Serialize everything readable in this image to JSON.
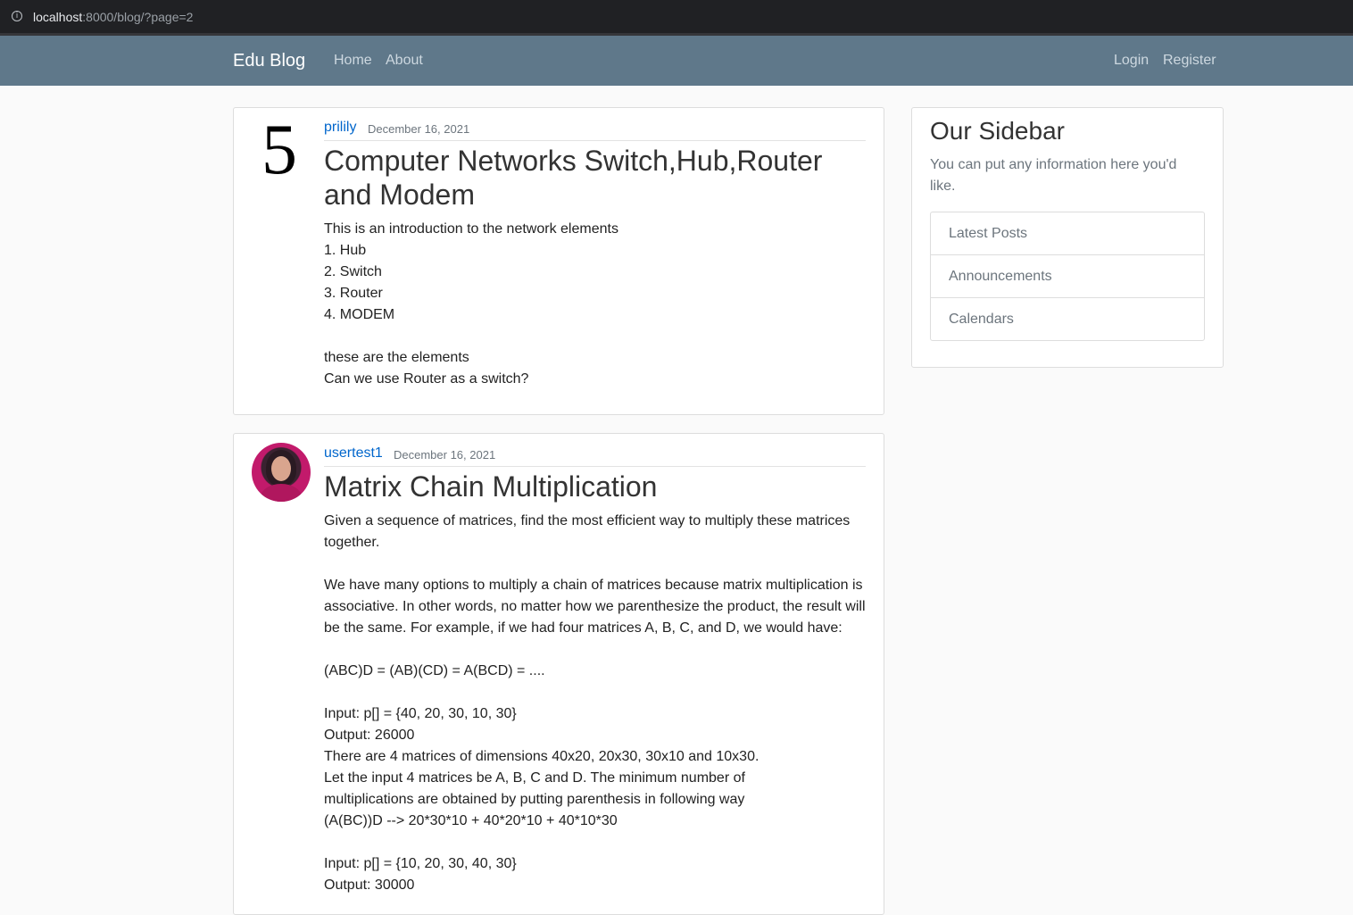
{
  "browser": {
    "url_host": "localhost",
    "url_rest": ":8000/blog/?page=2",
    "info_icon": "info-icon"
  },
  "navbar": {
    "brand": "Edu Blog",
    "links": {
      "home": "Home",
      "about": "About",
      "login": "Login",
      "register": "Register"
    },
    "background": "#5f788a"
  },
  "posts": [
    {
      "avatar_text": "5",
      "author": "prilily",
      "date": "December 16, 2021",
      "title": "Computer Networks Switch,Hub,Router and Modem",
      "content": "This is an introduction to the network elements\n1. Hub\n2. Switch\n3. Router\n4. MODEM\n\nthese are the elements\nCan we use Router as a switch?"
    },
    {
      "avatar_icon": "user-avatar-photo",
      "author": "usertest1",
      "date": "December 16, 2021",
      "title": "Matrix Chain Multiplication",
      "content": "Given a sequence of matrices, find the most efficient way to multiply these matrices together.\n\nWe have many options to multiply a chain of matrices because matrix multiplication is associative. In other words, no matter how we parenthesize the product, the result will be the same. For example, if we had four matrices A, B, C, and D, we would have:\n\n(ABC)D = (AB)(CD) = A(BCD) = ....\n\nInput: p[] = {40, 20, 30, 10, 30}\nOutput: 26000\nThere are 4 matrices of dimensions 40x20, 20x30, 30x10 and 10x30.\nLet the input 4 matrices be A, B, C and D. The minimum number of\nmultiplications are obtained by putting parenthesis in following way\n(A(BC))D --> 20*30*10 + 40*20*10 + 40*10*30\n\nInput: p[] = {10, 20, 30, 40, 30}\nOutput: 30000"
    }
  ],
  "sidebar": {
    "title": "Our Sidebar",
    "text": "You can put any information here you'd like.",
    "items": [
      "Latest Posts",
      "Announcements",
      "Calendars"
    ]
  },
  "colors": {
    "link": "#0066cc",
    "muted": "#6c757d"
  }
}
